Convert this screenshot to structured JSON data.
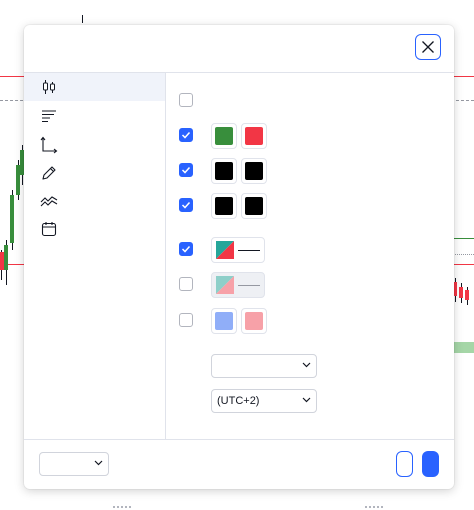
{
  "colors": {
    "accent": "#2962ff",
    "up": "#388e3c",
    "down": "#f23645",
    "black": "#000000",
    "up_light": "#8ecfa0",
    "down_light": "#f7a1a8",
    "blue_light": "#90aef8"
  },
  "dialog": {
    "close_icon": "close-icon"
  },
  "sidebar": {
    "items": [
      {
        "name": "symbol",
        "icon": "candles-icon",
        "active": true
      },
      {
        "name": "status-line",
        "icon": "status-line-icon",
        "active": false
      },
      {
        "name": "scales",
        "icon": "scales-axes-icon",
        "active": false
      },
      {
        "name": "canvas",
        "icon": "pencil-icon",
        "active": false
      },
      {
        "name": "trading",
        "icon": "trading-icon",
        "active": false
      },
      {
        "name": "events",
        "icon": "calendar-icon",
        "active": false
      }
    ]
  },
  "settings": {
    "rows": [
      {
        "checked": false
      },
      {
        "checked": true
      },
      {
        "checked": true
      },
      {
        "checked": true
      },
      {
        "checked": true
      },
      {
        "checked": false
      },
      {
        "checked": false
      }
    ],
    "timezone_select": {
      "value": "(UTC+2)"
    },
    "first_select": {
      "value": ""
    }
  },
  "footer": {
    "template_select": {
      "value": ""
    }
  }
}
